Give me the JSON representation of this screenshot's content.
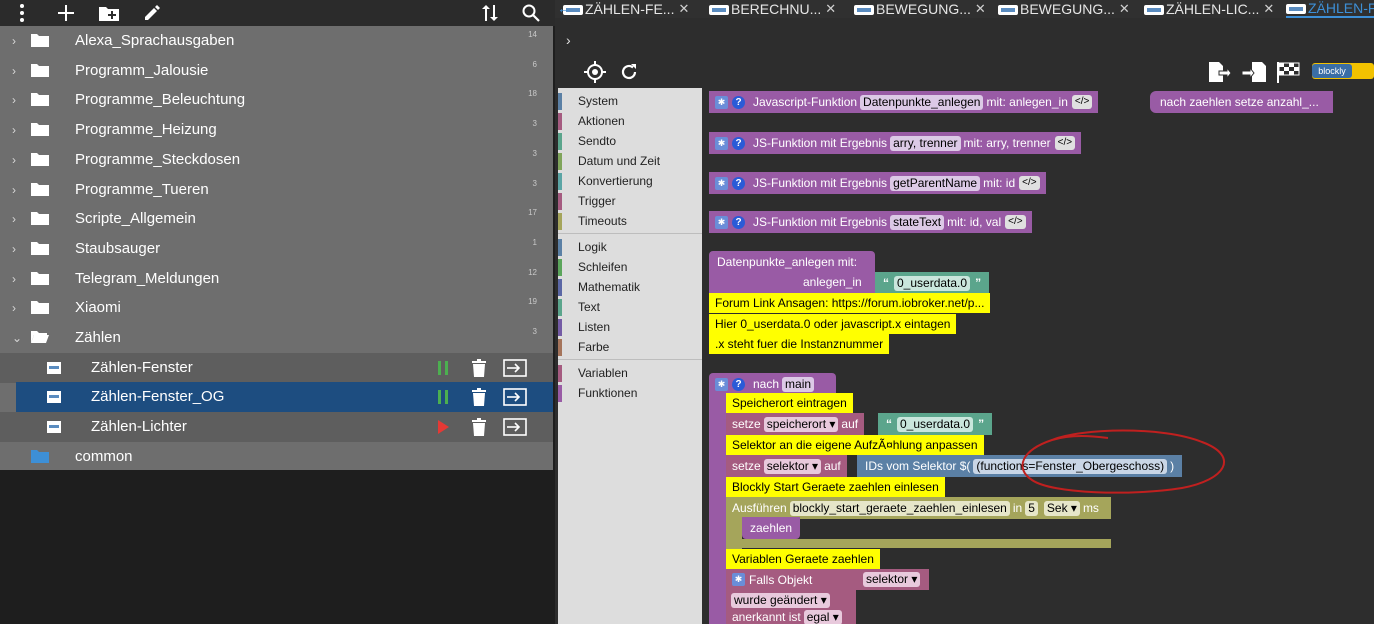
{
  "left_toolbar": {
    "buttons": [
      "more-vertical-icon",
      "add-icon",
      "new-folder-icon",
      "edit-icon"
    ],
    "right_buttons": [
      "sort-icon",
      "search-icon"
    ]
  },
  "tree": {
    "folders": [
      {
        "name": "Alexa_Sprachausgaben",
        "count": "14"
      },
      {
        "name": "Programm_Jalousie",
        "count": "6"
      },
      {
        "name": "Programme_Beleuchtung",
        "count": "18"
      },
      {
        "name": "Programme_Heizung",
        "count": "3"
      },
      {
        "name": "Programme_Steckdosen",
        "count": "3"
      },
      {
        "name": "Programme_Tueren",
        "count": "3"
      },
      {
        "name": "Scripte_Allgemein",
        "count": "17"
      },
      {
        "name": "Staubsauger",
        "count": "1"
      },
      {
        "name": "Telegram_Meldungen",
        "count": "12"
      },
      {
        "name": "Xiaomi",
        "count": "19"
      },
      {
        "name": "Zählen",
        "count": "3"
      }
    ],
    "scripts": [
      {
        "name": "Zählen-Fenster",
        "state": "paused"
      },
      {
        "name": "Zählen-Fenster_OG",
        "state": "paused"
      },
      {
        "name": "Zählen-Lichter",
        "state": "stopped"
      }
    ],
    "common": {
      "name": "common"
    }
  },
  "tabs": [
    {
      "label": "ZÄHLEN-FE..."
    },
    {
      "label": "BERECHNU..."
    },
    {
      "label": "BEWEGUNG..."
    },
    {
      "label": "BEWEGUNG..."
    },
    {
      "label": "ZÄHLEN-LIC..."
    },
    {
      "label": "ZÄHLEN-F"
    }
  ],
  "editor": {
    "blockly_badge": "blockly",
    "expand_chevron": "›"
  },
  "toolbox": {
    "groups": [
      [
        {
          "name": "System",
          "color": "#5b80a5"
        },
        {
          "name": "Aktionen",
          "color": "#a55b80"
        },
        {
          "name": "Sendto",
          "color": "#5ba58c"
        },
        {
          "name": "Datum und Zeit",
          "color": "#80a55b"
        },
        {
          "name": "Konvertierung",
          "color": "#5ba5a5"
        },
        {
          "name": "Trigger",
          "color": "#a55b80"
        },
        {
          "name": "Timeouts",
          "color": "#a5a55b"
        }
      ],
      [
        {
          "name": "Logik",
          "color": "#5b80a5"
        },
        {
          "name": "Schleifen",
          "color": "#5ba55b"
        },
        {
          "name": "Mathematik",
          "color": "#5b67a5"
        },
        {
          "name": "Text",
          "color": "#5ba58c"
        },
        {
          "name": "Listen",
          "color": "#745ba5"
        },
        {
          "name": "Farbe",
          "color": "#a5745b"
        }
      ],
      [
        {
          "name": "Variablen",
          "color": "#a55b80"
        },
        {
          "name": "Funktionen",
          "color": "#995ba5"
        }
      ]
    ]
  },
  "blocks": {
    "fn1": {
      "label": "Javascript-Funktion",
      "name": "Datenpunkte_anlegen",
      "mit": "mit: anlegen_in",
      "code": "</>"
    },
    "fn2": {
      "label": "JS-Funktion mit Ergebnis",
      "name": "arry, trenner",
      "mit": "mit: arry, trenner",
      "code": "</>"
    },
    "fn3": {
      "label": "JS-Funktion mit Ergebnis",
      "name": "getParentName",
      "mit": "mit: id",
      "code": "</>"
    },
    "fn4": {
      "label": "JS-Funktion mit Ergebnis",
      "name": "stateText",
      "mit": "mit: id, val",
      "code": "</>"
    },
    "call_top": "nach zaehlen  setze anzahl_...",
    "dp_call": {
      "label": "Datenpunkte_anlegen  mit:",
      "arg_label": "anlegen_in",
      "arg_value": "0_userdata.0"
    },
    "comments1": [
      "Forum Link Ansagen: https://forum.iobroker.net/p...",
      "Hier 0_userdata.0 oder javascript.x eintagen",
      ".x steht fuer die Instanznummer"
    ],
    "main": {
      "header_label": "nach",
      "header_name": "main",
      "comment_speicher": "Speicherort eintragen",
      "set1_label": "setze",
      "set1_var": "speicherort",
      "set1_auf": "auf",
      "set1_value": "0_userdata.0",
      "comment_selektor": "Selektor an die eigene AufzÃ¤hlung anpassen",
      "set2_label": "setze",
      "set2_var": "selektor",
      "set2_auf": "auf",
      "selector_label": "IDs vom Selektor $(",
      "selector_value": "(functions=Fenster_Obergeschoss)",
      "selector_close": ")",
      "comment_start": "Blockly Start Geraete zaehlen einlesen",
      "exec_label": "Ausführen",
      "exec_name": "blockly_start_geraete_zaehlen_einlesen",
      "exec_in": "in",
      "exec_num": "5",
      "exec_unit": "Sek",
      "exec_ms": "ms",
      "exec_inner": "zaehlen",
      "comment_var": "Variablen Geraete zaehlen",
      "falls_label": "Falls Objekt",
      "falls_var": "selektor",
      "changed": "wurde geändert",
      "ack_label": "anerkannt ist",
      "ack_value": "egal"
    }
  }
}
